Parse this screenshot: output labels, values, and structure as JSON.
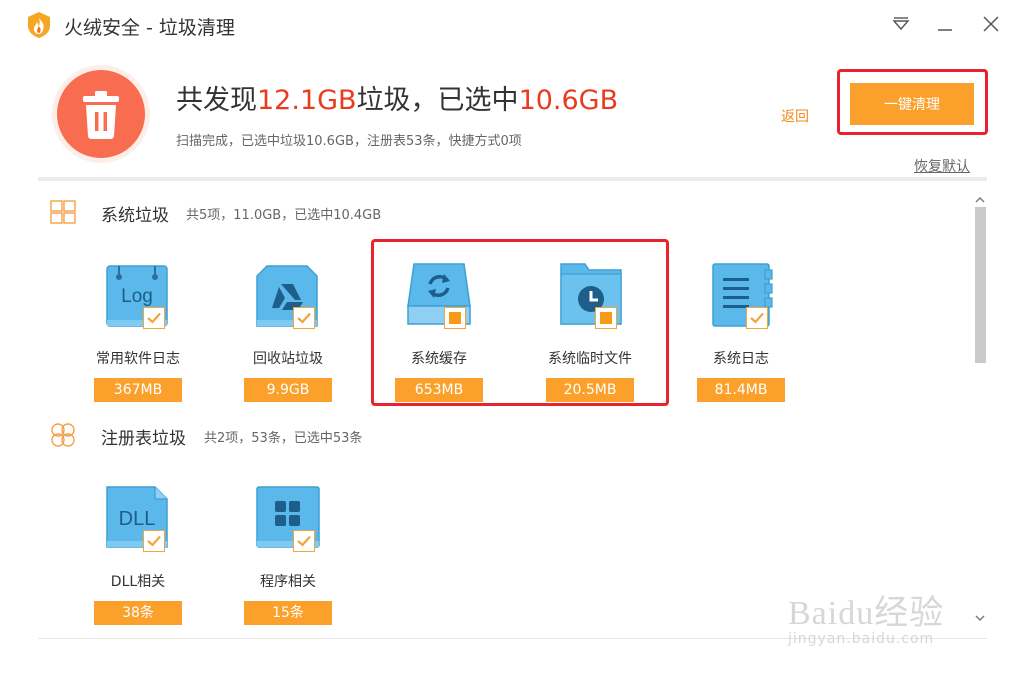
{
  "window": {
    "title": "火绒安全 - 垃圾清理"
  },
  "summary": {
    "headline_prefix": "共发现",
    "found_size": "12.1GB",
    "headline_mid": "垃圾，已选中",
    "selected_size": "10.6GB",
    "subline": "扫描完成，已选中垃圾10.6GB，注册表53条，快捷方式0项"
  },
  "actions": {
    "back_label": "返回",
    "clean_label": "一键清理",
    "restore_label": "恢复默认"
  },
  "sections": [
    {
      "title": "系统垃圾",
      "summary": "共5项，11.0GB，已选中10.4GB",
      "items": [
        {
          "label": "常用软件日志",
          "size": "367MB",
          "icon": "log-file-icon",
          "state": "checked"
        },
        {
          "label": "回收站垃圾",
          "size": "9.9GB",
          "icon": "recycle-bin-icon",
          "state": "checked"
        },
        {
          "label": "系统缓存",
          "size": "653MB",
          "icon": "system-cache-icon",
          "state": "partial"
        },
        {
          "label": "系统临时文件",
          "size": "20.5MB",
          "icon": "temp-folder-icon",
          "state": "partial"
        },
        {
          "label": "系统日志",
          "size": "81.4MB",
          "icon": "system-log-icon",
          "state": "checked"
        }
      ]
    },
    {
      "title": "注册表垃圾",
      "summary": "共2项，53条，已选中53条",
      "items": [
        {
          "label": "DLL相关",
          "size": "38条",
          "icon": "dll-file-icon",
          "state": "checked"
        },
        {
          "label": "程序相关",
          "size": "15条",
          "icon": "program-blocks-icon",
          "state": "checked"
        }
      ]
    }
  ],
  "watermark": {
    "main": "Baidu经验",
    "sub": "jingyan.baidu.com"
  },
  "colors": {
    "accent": "#fba12b",
    "highlight_red": "#e93b1e",
    "icon_blue": "#5ab8ea",
    "annotation_red": "#e8232d"
  }
}
